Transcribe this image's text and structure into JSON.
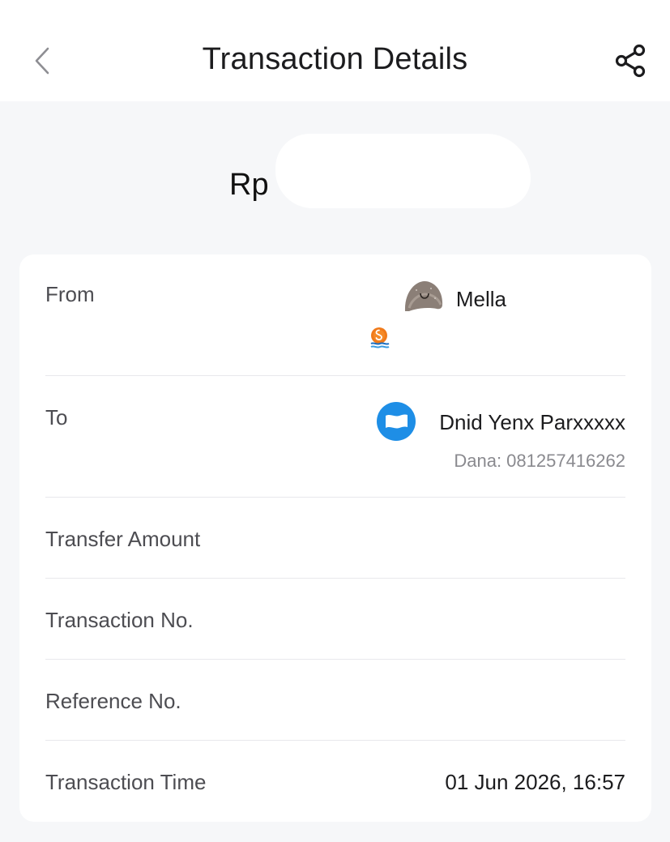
{
  "header": {
    "title": "Transaction Details",
    "back_icon": "chevron-left-icon",
    "share_icon": "share-icon"
  },
  "amount": {
    "currency": "Rp",
    "value_masked": true
  },
  "details": {
    "from": {
      "label": "From",
      "name": "Mella"
    },
    "to": {
      "label": "To",
      "name": "Dnid Yenx Parxxxxx",
      "account": "Dana: 081257416262"
    },
    "transfer_amount": {
      "label": "Transfer Amount"
    },
    "transaction_no": {
      "label": "Transaction No."
    },
    "reference_no": {
      "label": "Reference No."
    },
    "transaction_time": {
      "label": "Transaction Time",
      "value": "01 Jun 2026, 16:57"
    }
  },
  "colors": {
    "background": "#f6f7f9",
    "card": "#ffffff",
    "dana_blue": "#1e8ee6",
    "bank_orange": "#f07a1a",
    "label_gray": "#4d4d52",
    "sub_gray": "#8a8a8f"
  }
}
